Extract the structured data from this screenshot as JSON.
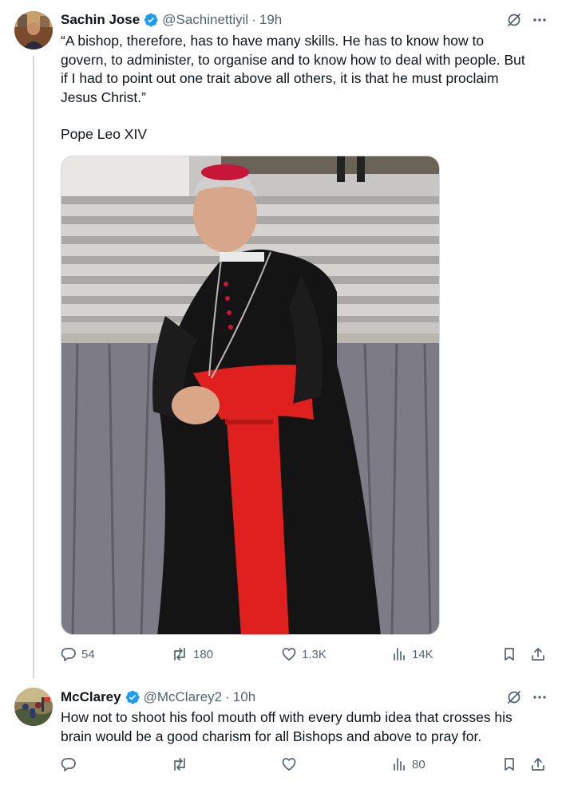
{
  "tweets": [
    {
      "author_name": "Sachin Jose",
      "handle": "@Sachinettiyil",
      "separator": "·",
      "time": "19h",
      "text_lines": [
        "“A bishop, therefore, has to have many skills. He has to know how to",
        "govern, to administer, to organise and to know how to deal with people. But",
        "if I had to point out one trait above all others, it is that he must proclaim",
        "Jesus Christ.”"
      ],
      "attribution": "Pope Leo XIV",
      "stats": {
        "replies": "54",
        "reposts": "180",
        "likes": "1.3K",
        "views": "14K"
      }
    },
    {
      "author_name": "McClarey",
      "handle": "@McClarey2",
      "separator": "·",
      "time": "10h",
      "text_lines": [
        "How not to shoot his fool mouth off with every dumb idea that crosses his",
        "brain would be a good charism for all Bishops and above to pray for."
      ],
      "stats": {
        "views": "80"
      }
    }
  ],
  "icons": {
    "verified": "verified-badge-icon",
    "grok": "grok-icon",
    "more": "more-icon",
    "reply": "reply-icon",
    "repost": "repost-icon",
    "like": "like-icon",
    "views": "views-icon",
    "bookmark": "bookmark-icon",
    "share": "share-icon"
  },
  "colors": {
    "text": "#0f1419",
    "secondary": "#536471",
    "verified": "#1d9bf0",
    "thread_line": "#cfd9de",
    "cassock_red": "#e0201e"
  }
}
